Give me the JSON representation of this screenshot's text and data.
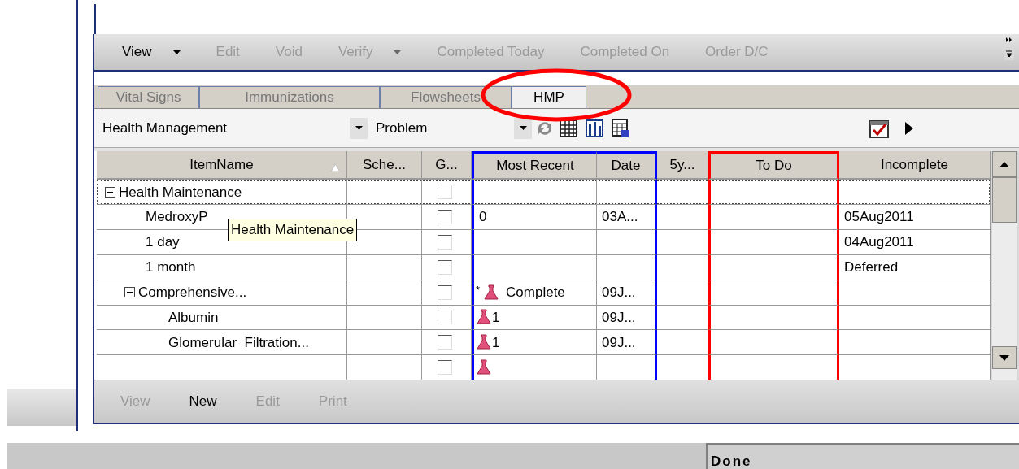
{
  "toolbar": [
    {
      "label": "View",
      "disabled": false,
      "dropdown": true
    },
    {
      "label": "Edit",
      "disabled": true,
      "dropdown": false
    },
    {
      "label": "Void",
      "disabled": true,
      "dropdown": false
    },
    {
      "label": "Verify",
      "disabled": true,
      "dropdown": true
    },
    {
      "label": "Completed Today",
      "disabled": true,
      "dropdown": false
    },
    {
      "label": "Completed On",
      "disabled": true,
      "dropdown": false
    },
    {
      "label": "Order D/C",
      "disabled": true,
      "dropdown": false
    }
  ],
  "tabs": [
    {
      "label": "Vital Signs",
      "selected": false
    },
    {
      "label": "Immunizations",
      "selected": false
    },
    {
      "label": "Flowsheets",
      "selected": false
    },
    {
      "label": "HMP",
      "selected": true,
      "circled": true
    }
  ],
  "filters": [
    {
      "value": "Health Management"
    },
    {
      "value": "Problem"
    }
  ],
  "table": {
    "columns": [
      {
        "label": "ItemName",
        "sorted": true
      },
      {
        "label": "Sche..."
      },
      {
        "label": "G..."
      },
      {
        "label": "Most Recent",
        "color": "#0000ff"
      },
      {
        "label": "Date",
        "color": "#0000ff"
      },
      {
        "label": "5y..."
      },
      {
        "label": "To Do",
        "color": "#ff0000"
      },
      {
        "label": "Incomplete"
      }
    ],
    "rows": [
      {
        "name": "Health Maintenance",
        "expanded": true,
        "checked": false,
        "focused": true,
        "tooltip": "Health Maintenance",
        "children": [
          {
            "name": "MedroxyP",
            "checked": false,
            "most_recent": "0",
            "date": "03A...",
            "incomplete": "05Aug2011"
          },
          {
            "name": "1 day",
            "checked": false,
            "incomplete": "04Aug2011"
          },
          {
            "name": "1 month",
            "checked": false,
            "incomplete": "Deferred"
          },
          {
            "name": "Comprehensive...",
            "expanded": true,
            "checked": false,
            "marker": "*",
            "result": true,
            "most_recent": "Complete",
            "date": "09J...",
            "children": [
              {
                "name": "Albumin",
                "checked": false,
                "result": true,
                "most_recent": "1",
                "date": "09J..."
              },
              {
                "name": "Glomerular  Filtration...",
                "checked": false,
                "result": true,
                "most_recent": "1",
                "date": "09J..."
              },
              {
                "checked": false,
                "result": true
              }
            ]
          }
        ]
      }
    ]
  },
  "bottom_toolbar": [
    {
      "label": "View",
      "disabled": true
    },
    {
      "label": "New",
      "disabled": false
    },
    {
      "label": "Edit",
      "disabled": true
    },
    {
      "label": "Print",
      "disabled": true
    }
  ],
  "status_bar": {
    "text": "Done"
  }
}
